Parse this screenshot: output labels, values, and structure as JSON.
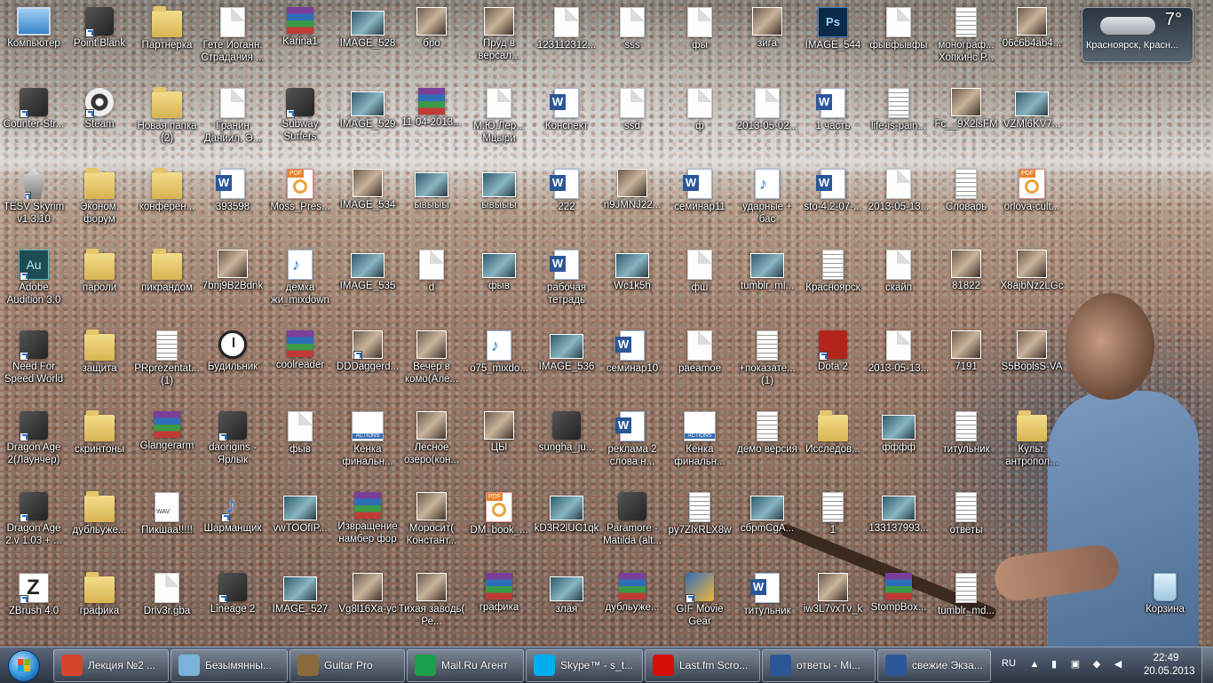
{
  "desktop_icons": [
    {
      "label": "Компьютер",
      "type": "computer",
      "shortcut": false
    },
    {
      "label": "Point Blank",
      "type": "app",
      "shortcut": true
    },
    {
      "label": "Партнерка",
      "type": "folder",
      "shortcut": false
    },
    {
      "label": "Гете Иоганн. Страдания ...",
      "type": "doc",
      "shortcut": false
    },
    {
      "label": "Karina1",
      "type": "winrar",
      "shortcut": false
    },
    {
      "label": "IMAGE_528",
      "type": "image",
      "shortcut": false
    },
    {
      "label": "бро",
      "type": "photo",
      "shortcut": false
    },
    {
      "label": "Пруд в версал...",
      "type": "photo",
      "shortcut": false
    },
    {
      "label": "123112312...",
      "type": "doc",
      "shortcut": false
    },
    {
      "label": "sss",
      "type": "doc",
      "shortcut": false
    },
    {
      "label": "фы",
      "type": "doc",
      "shortcut": false
    },
    {
      "label": "зига",
      "type": "photo",
      "shortcut": false
    },
    {
      "label": "IMAGE_544",
      "type": "psd",
      "shortcut": false
    },
    {
      "label": "фывфывфы",
      "type": "doc",
      "shortcut": false
    },
    {
      "label": "монограф... Хопкинс Р...",
      "type": "paper",
      "shortcut": false
    },
    {
      "label": "06c6b4ab4...",
      "type": "photo",
      "shortcut": false
    },
    {
      "label": "Counter-Str...",
      "type": "app",
      "shortcut": true
    },
    {
      "label": "Steam",
      "type": "steam",
      "shortcut": true
    },
    {
      "label": "Новая папка (2)",
      "type": "folder",
      "shortcut": false
    },
    {
      "label": "Гранин Даниил. Э...",
      "type": "doc",
      "shortcut": false
    },
    {
      "label": "Subway Surfers",
      "type": "app",
      "shortcut": true
    },
    {
      "label": "IMAGE_529",
      "type": "image",
      "shortcut": false
    },
    {
      "label": "11-04-2013...",
      "type": "winrar",
      "shortcut": false
    },
    {
      "label": "М.Ю.Лер... Мцыри",
      "type": "doc",
      "shortcut": false
    },
    {
      "label": "Конспект",
      "type": "word",
      "shortcut": false
    },
    {
      "label": "ssd",
      "type": "doc",
      "shortcut": false
    },
    {
      "label": "ф",
      "type": "doc",
      "shortcut": false
    },
    {
      "label": "2013-05-02...",
      "type": "doc",
      "shortcut": false
    },
    {
      "label": "1 часть",
      "type": "word",
      "shortcut": false
    },
    {
      "label": "life-is-pain...",
      "type": "paper",
      "shortcut": false
    },
    {
      "label": "Fc__9X2lsFM",
      "type": "photo",
      "shortcut": false
    },
    {
      "label": "VZMl6KV7...",
      "type": "image",
      "shortcut": false
    },
    {
      "label": "TESV Skyrim v1.3.10",
      "type": "skyrim",
      "shortcut": true
    },
    {
      "label": "Эконом. форум",
      "type": "folder",
      "shortcut": false
    },
    {
      "label": "конферен...",
      "type": "folder",
      "shortcut": false
    },
    {
      "label": "393598",
      "type": "word",
      "shortcut": false
    },
    {
      "label": "Moss_Pres...",
      "type": "pdf",
      "shortcut": false
    },
    {
      "label": "IMAGE_534",
      "type": "photo",
      "shortcut": false
    },
    {
      "label": "ывыыы",
      "type": "image",
      "shortcut": false
    },
    {
      "label": "ывыыы",
      "type": "image",
      "shortcut": false
    },
    {
      "label": "222",
      "type": "word",
      "shortcut": false
    },
    {
      "label": "n9JMNJ22...",
      "type": "photo",
      "shortcut": false
    },
    {
      "label": "семинар11",
      "type": "word",
      "shortcut": false
    },
    {
      "label": "ударные + бас",
      "type": "audio",
      "shortcut": false
    },
    {
      "label": "sto-4.2-07-...",
      "type": "word",
      "shortcut": false
    },
    {
      "label": "2013-05-13...",
      "type": "doc",
      "shortcut": false
    },
    {
      "label": "Словарь",
      "type": "paper",
      "shortcut": false
    },
    {
      "label": "orlova-cult...",
      "type": "pdf",
      "shortcut": false
    },
    {
      "label": "Adobe Audition 3.0",
      "type": "au",
      "shortcut": true
    },
    {
      "label": "пароли",
      "type": "folder",
      "shortcut": false
    },
    {
      "label": "пикрандом",
      "type": "folder",
      "shortcut": false
    },
    {
      "label": "7bnj9B2Bdnk",
      "type": "photo",
      "shortcut": false
    },
    {
      "label": "демка жи_mixdown",
      "type": "audio",
      "shortcut": false
    },
    {
      "label": "IMAGE_535",
      "type": "image",
      "shortcut": false
    },
    {
      "label": "d",
      "type": "doc",
      "shortcut": false
    },
    {
      "label": "фыв",
      "type": "image",
      "shortcut": false
    },
    {
      "label": "рабочая тетрадь",
      "type": "word",
      "shortcut": false
    },
    {
      "label": "Wc1k5h",
      "type": "image",
      "shortcut": false
    },
    {
      "label": "фш",
      "type": "doc",
      "shortcut": false
    },
    {
      "label": "tumblr_ml...",
      "type": "image",
      "shortcut": false
    },
    {
      "label": "Красноярск",
      "type": "paper",
      "shortcut": false
    },
    {
      "label": "скайп",
      "type": "doc",
      "shortcut": false
    },
    {
      "label": "81822",
      "type": "photo",
      "shortcut": false
    },
    {
      "label": "X8ajbNz2LGc",
      "type": "photo",
      "shortcut": false
    },
    {
      "label": "Need For Speed World",
      "type": "app",
      "shortcut": true
    },
    {
      "label": "защита",
      "type": "folder",
      "shortcut": false
    },
    {
      "label": "PRprezentat... (1)",
      "type": "paper",
      "shortcut": false
    },
    {
      "label": "Будильник",
      "type": "clock",
      "shortcut": false
    },
    {
      "label": "coolreader",
      "type": "winrar",
      "shortcut": false
    },
    {
      "label": "DDDaggerd...",
      "type": "photo",
      "shortcut": true
    },
    {
      "label": "Вечер в комо(Але...",
      "type": "photo",
      "shortcut": false
    },
    {
      "label": "o75_mixdo...",
      "type": "audio",
      "shortcut": false
    },
    {
      "label": "IMAGE_536",
      "type": "image",
      "shortcut": false
    },
    {
      "label": "семинар10",
      "type": "word",
      "shortcut": false
    },
    {
      "label": "рaeamoe",
      "type": "doc",
      "shortcut": false
    },
    {
      "label": "+показате... (1)",
      "type": "paper",
      "shortcut": false
    },
    {
      "label": "Dota 2",
      "type": "dota",
      "shortcut": true
    },
    {
      "label": "2013-05-13...",
      "type": "doc",
      "shortcut": false
    },
    {
      "label": "7191",
      "type": "photo",
      "shortcut": false
    },
    {
      "label": "S5BoplsS-VA",
      "type": "photo",
      "shortcut": false
    },
    {
      "label": "Dragon Age 2(Лаунчер)",
      "type": "app",
      "shortcut": true
    },
    {
      "label": "скринтоны",
      "type": "folder",
      "shortcut": false
    },
    {
      "label": "Glangerarm",
      "type": "winrar",
      "shortcut": false
    },
    {
      "label": "daorigins - Ярлык",
      "type": "app",
      "shortcut": true
    },
    {
      "label": "фыв",
      "type": "doc",
      "shortcut": false
    },
    {
      "label": "Кенка финальн...",
      "type": "actions",
      "shortcut": false
    },
    {
      "label": "Лесное озеро(кон...",
      "type": "photo",
      "shortcut": false
    },
    {
      "label": "ЦЫ",
      "type": "photo",
      "shortcut": false
    },
    {
      "label": "sungha_ju...",
      "type": "app",
      "shortcut": false
    },
    {
      "label": "реклама 2 слова н...",
      "type": "word",
      "shortcut": false
    },
    {
      "label": "Кенка финальн...",
      "type": "actions",
      "shortcut": false
    },
    {
      "label": "демо версия",
      "type": "paper",
      "shortcut": false
    },
    {
      "label": "Исследов...",
      "type": "folder",
      "shortcut": false
    },
    {
      "label": "фффф",
      "type": "image",
      "shortcut": false
    },
    {
      "label": "титульник",
      "type": "paper",
      "shortcut": false
    },
    {
      "label": "Культ. антропол...",
      "type": "folder",
      "shortcut": false
    },
    {
      "label": "Dragon Age 2.v 1.03 + ...",
      "type": "app",
      "shortcut": true
    },
    {
      "label": "дубльуже...",
      "type": "folder",
      "shortcut": false
    },
    {
      "label": "Пикшаа!!!!!",
      "type": "wav",
      "shortcut": false
    },
    {
      "label": "Шарманщик",
      "type": "note",
      "shortcut": true
    },
    {
      "label": "vwTOOfIP...",
      "type": "image",
      "shortcut": false
    },
    {
      "label": "Извращение намбер фор",
      "type": "winrar",
      "shortcut": false
    },
    {
      "label": "Моросит( Констант...",
      "type": "photo",
      "shortcut": false
    },
    {
      "label": "DM_book_...",
      "type": "pdf",
      "shortcut": false
    },
    {
      "label": "kD3R2lUC1qk",
      "type": "image",
      "shortcut": false
    },
    {
      "label": "Paramore - Matilda (alt...",
      "type": "app",
      "shortcut": false
    },
    {
      "label": "py7ZlxRLX8w",
      "type": "paper",
      "shortcut": false
    },
    {
      "label": "сбрmCgA...",
      "type": "image",
      "shortcut": false
    },
    {
      "label": "1",
      "type": "paper",
      "shortcut": false
    },
    {
      "label": "133137993...",
      "type": "image",
      "shortcut": false
    },
    {
      "label": "ответы",
      "type": "paper",
      "shortcut": false
    },
    {
      "label": "",
      "type": "none",
      "shortcut": false
    },
    {
      "label": "ZBrush 4.0",
      "type": "zbrush",
      "shortcut": true
    },
    {
      "label": "графика",
      "type": "folder",
      "shortcut": false
    },
    {
      "label": "Drlv3r.gba",
      "type": "doc",
      "shortcut": false
    },
    {
      "label": "Lineage 2",
      "type": "app",
      "shortcut": true
    },
    {
      "label": "IMAGE_527",
      "type": "image",
      "shortcut": false
    },
    {
      "label": "Vg8l16Xa-yc",
      "type": "photo",
      "shortcut": false
    },
    {
      "label": "Тихая заводь( Ре...",
      "type": "photo",
      "shortcut": false
    },
    {
      "label": "графика",
      "type": "winrar",
      "shortcut": false
    },
    {
      "label": "злая",
      "type": "image",
      "shortcut": false
    },
    {
      "label": "дубльуже...",
      "type": "winrar",
      "shortcut": false
    },
    {
      "label": "GIF Movie Gear",
      "type": "gif",
      "shortcut": true
    },
    {
      "label": "титульник",
      "type": "word",
      "shortcut": false
    },
    {
      "label": "iw3L7vxTv_k",
      "type": "photo",
      "shortcut": false
    },
    {
      "label": "StompBox...",
      "type": "winrar",
      "shortcut": false
    },
    {
      "label": "tumblr_md...",
      "type": "paper",
      "shortcut": false
    },
    {
      "label": "Корзина",
      "type": "bin",
      "shortcut": false
    }
  ],
  "weather": {
    "temperature": "7°",
    "city": "Красноярск, Красн..."
  },
  "taskbar": {
    "items": [
      {
        "label": "Лекция №2 ...",
        "color": "#d5452d"
      },
      {
        "label": "Безымянны...",
        "color": "#7ab3d8"
      },
      {
        "label": "Guitar Pro",
        "color": "#8a6a3a"
      },
      {
        "label": "Mail.Ru Агент",
        "color": "#1aa04b"
      },
      {
        "label": "Skype™ - s_t...",
        "color": "#00aff0"
      },
      {
        "label": "Last.fm Scro...",
        "color": "#d51007"
      },
      {
        "label": "ответы - Mi...",
        "color": "#2b5797"
      },
      {
        "label": "свежие Экза...",
        "color": "#2b5797"
      }
    ],
    "tray": {
      "language": "RU",
      "time": "22:49",
      "date": "20.05.2013"
    }
  }
}
